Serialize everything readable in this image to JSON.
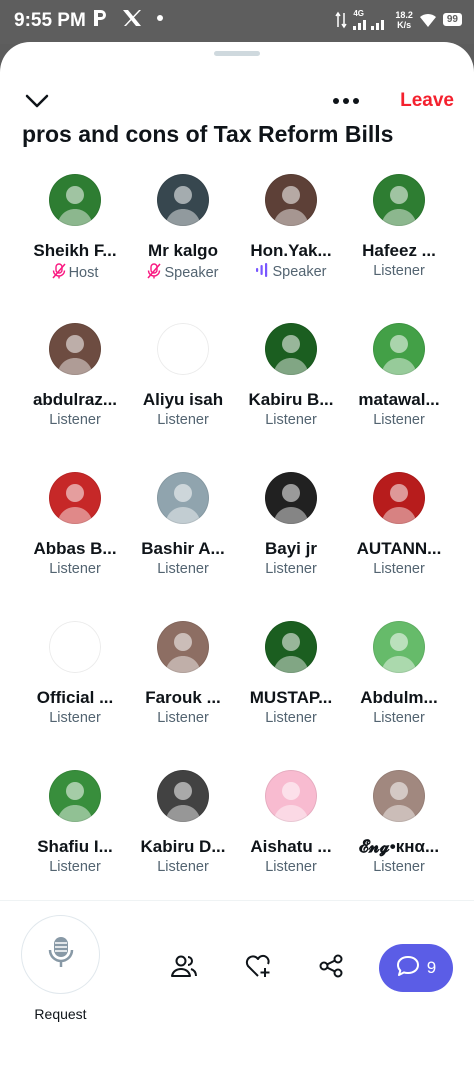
{
  "status_bar": {
    "time": "9:55 PM",
    "network_label": "4G",
    "speed_value": "18.2",
    "speed_unit": "K/s",
    "battery": "99",
    "icons": [
      "p-app-icon",
      "x-logo-icon",
      "dot-icon",
      "signal-icon",
      "wifi-icon",
      "battery-icon"
    ]
  },
  "header": {
    "leave_label": "Leave"
  },
  "space": {
    "title": "pros and cons of Tax Reform Bills"
  },
  "participants": [
    {
      "name": "Sheikh F...",
      "role": "Host",
      "role_icon": "mic-off-icon",
      "avatar_color": "#2e7d32"
    },
    {
      "name": "Mr kalgo",
      "role": "Speaker",
      "role_icon": "mic-off-icon",
      "avatar_color": "#37474f"
    },
    {
      "name": "Hon.Yak...",
      "role": "Speaker",
      "role_icon": "speaking-bars-icon",
      "avatar_color": "#5d4037"
    },
    {
      "name": "Hafeez ...",
      "role": "Listener",
      "role_icon": "",
      "avatar_color": "#2e7d32"
    },
    {
      "name": "abdulraz...",
      "role": "Listener",
      "role_icon": "",
      "avatar_color": "#6d4c41"
    },
    {
      "name": "Aliyu isah",
      "role": "Listener",
      "role_icon": "",
      "avatar_color": "#ffffff"
    },
    {
      "name": "Kabiru B...",
      "role": "Listener",
      "role_icon": "",
      "avatar_color": "#1b5e20"
    },
    {
      "name": "matawal...",
      "role": "Listener",
      "role_icon": "",
      "avatar_color": "#43a047"
    },
    {
      "name": "Abbas B...",
      "role": "Listener",
      "role_icon": "",
      "avatar_color": "#c62828"
    },
    {
      "name": "Bashir A...",
      "role": "Listener",
      "role_icon": "",
      "avatar_color": "#90a4ae"
    },
    {
      "name": "Bayi jr",
      "role": "Listener",
      "role_icon": "",
      "avatar_color": "#212121"
    },
    {
      "name": "AUTANN...",
      "role": "Listener",
      "role_icon": "",
      "avatar_color": "#b71c1c"
    },
    {
      "name": "Official ...",
      "role": "Listener",
      "role_icon": "",
      "avatar_color": "#ffffff"
    },
    {
      "name": "Farouk ...",
      "role": "Listener",
      "role_icon": "",
      "avatar_color": "#8d6e63"
    },
    {
      "name": "MUSTAP...",
      "role": "Listener",
      "role_icon": "",
      "avatar_color": "#1b5e20"
    },
    {
      "name": "Abdulm...",
      "role": "Listener",
      "role_icon": "",
      "avatar_color": "#66bb6a"
    },
    {
      "name": "Shafiu I...",
      "role": "Listener",
      "role_icon": "",
      "avatar_color": "#388e3c"
    },
    {
      "name": "Kabiru D...",
      "role": "Listener",
      "role_icon": "",
      "avatar_color": "#424242"
    },
    {
      "name": "Aishatu ...",
      "role": "Listener",
      "role_icon": "",
      "avatar_color": "#f8bbd0"
    },
    {
      "name": "𝓔𝓷𝓰•кнα...",
      "role": "Listener",
      "role_icon": "",
      "avatar_color": "#a1887f"
    }
  ],
  "bottom_bar": {
    "request_label": "Request",
    "chat_count": "9",
    "accent": "#5b5de6",
    "icons": [
      "microphone-icon",
      "people-icon",
      "heart-plus-icon",
      "share-icon",
      "chat-bubble-icon"
    ]
  }
}
